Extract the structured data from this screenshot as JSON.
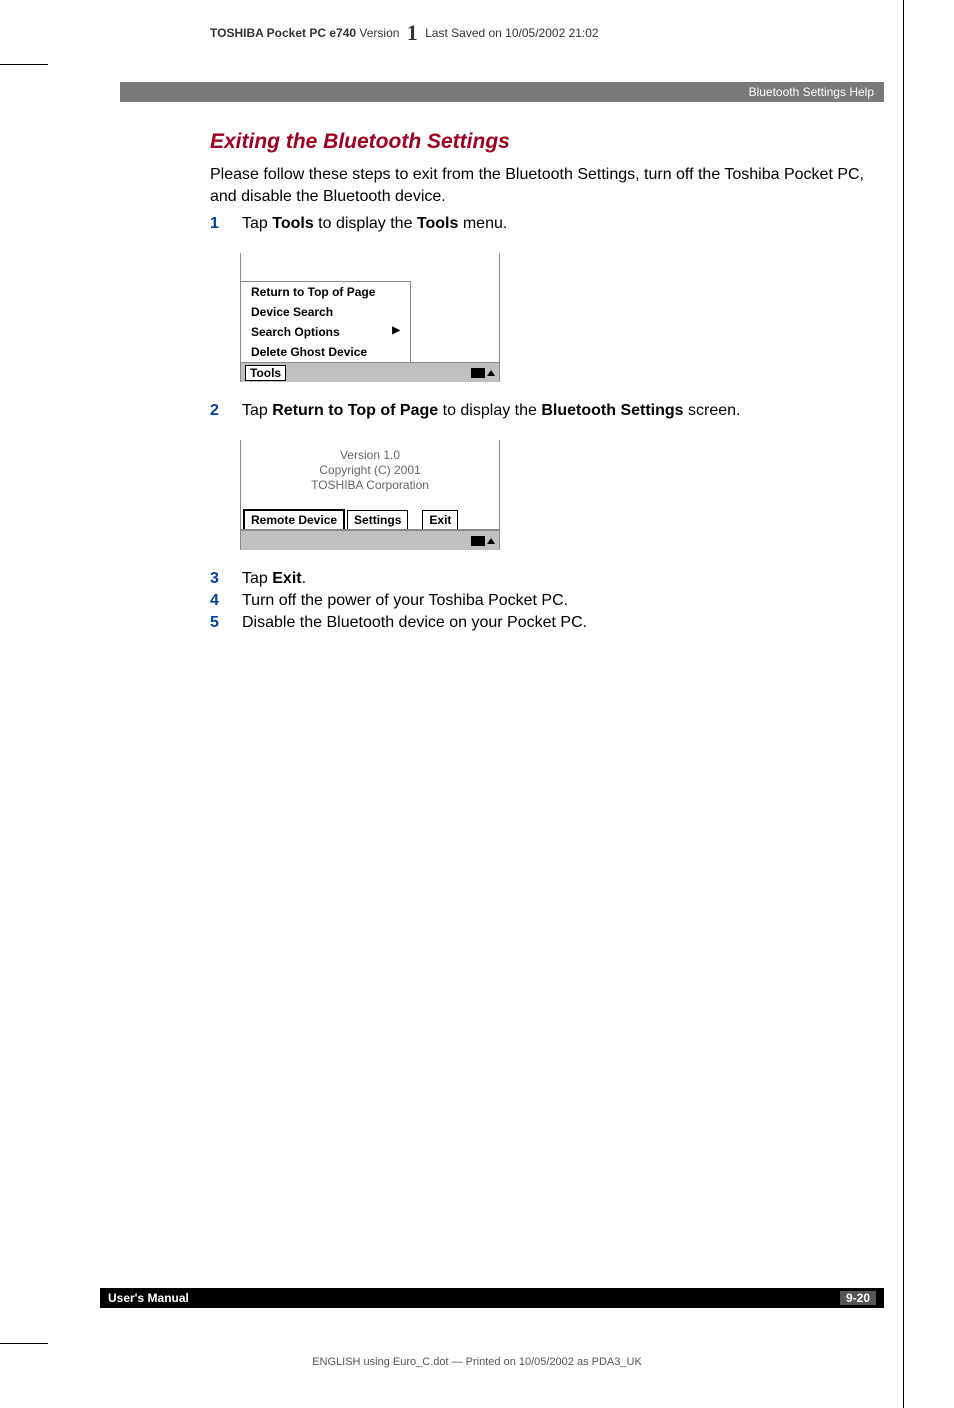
{
  "header": {
    "product_bold": "TOSHIBA Pocket PC e740",
    "version_word": "Version",
    "version_num": "1",
    "saved": "Last Saved on 10/05/2002 21:02"
  },
  "banner": "Bluetooth Settings Help",
  "title": "Exiting the Bluetooth Settings",
  "intro": "Please follow these steps to exit from the Bluetooth Settings, turn off the Toshiba Pocket PC, and disable the Bluetooth device.",
  "steps": {
    "s1": {
      "num": "1",
      "pre": "Tap ",
      "b1": "Tools",
      "mid": " to display the ",
      "b2": "Tools",
      "post": " menu."
    },
    "s2": {
      "num": "2",
      "pre": "Tap ",
      "b1": "Return to Top of Page",
      "mid": " to display the ",
      "b2": "Bluetooth Settings",
      "post": " screen."
    },
    "s3": {
      "num": "3",
      "pre": "Tap ",
      "b1": "Exit",
      "post": "."
    },
    "s4": {
      "num": "4",
      "txt": "Turn off the power of your Toshiba Pocket PC."
    },
    "s5": {
      "num": "5",
      "txt": "Disable the Bluetooth device on your Pocket PC."
    }
  },
  "shot1": {
    "menu": {
      "i1": "Return to Top of Page",
      "i2": "Device Search",
      "i3": "Search Options",
      "i4": "Delete Ghost Device"
    },
    "tools_label": "Tools"
  },
  "shot2": {
    "line1": "Version 1.0",
    "line2": "Copyright (C) 2001",
    "line3": "TOSHIBA Corporation",
    "tabs": {
      "t1": "Remote Device",
      "t2": "Settings",
      "t3": "Exit"
    }
  },
  "footer": {
    "left": "User's Manual",
    "right": "9-20"
  },
  "printline": "ENGLISH using  Euro_C.dot — Printed on 10/05/2002 as PDA3_UK"
}
